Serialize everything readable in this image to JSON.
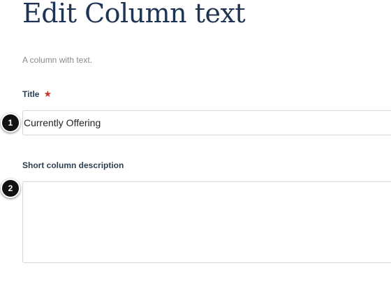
{
  "header": {
    "title": "Edit Column text",
    "description": "A column with text."
  },
  "form": {
    "title_field": {
      "label": "Title",
      "required_marker": "★",
      "value": "Currently Offering"
    },
    "description_field": {
      "label": "Short column description",
      "value": ""
    }
  },
  "callouts": {
    "first": "1",
    "second": "2"
  },
  "colors": {
    "title_text": "#1f3352",
    "label_text": "#2c3e50",
    "muted_text": "#8a8a8a",
    "required_star": "#c0392b",
    "input_border": "#d6d6d6",
    "callout_fill": "#111111"
  }
}
